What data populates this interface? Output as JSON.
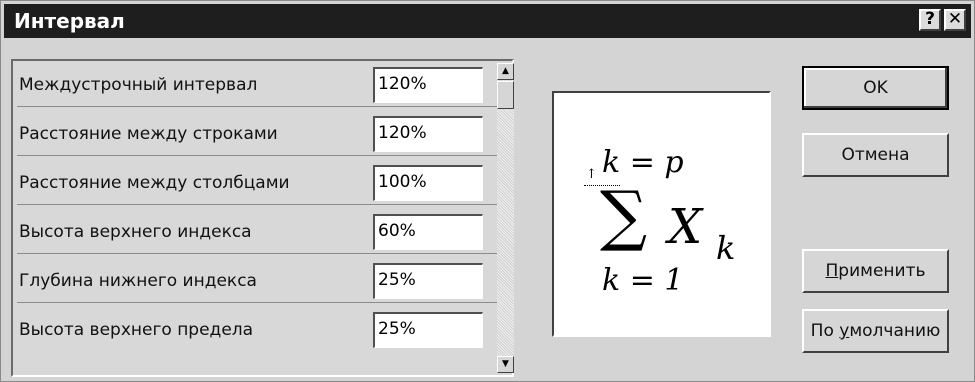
{
  "window": {
    "title": "Интервал",
    "help_label": "?",
    "close_label": "✕"
  },
  "settings": [
    {
      "label": "Междустрочный интервал",
      "value": "120%"
    },
    {
      "label": "Расстояние между строками",
      "value": "120%"
    },
    {
      "label": "Расстояние между столбцами",
      "value": "100%"
    },
    {
      "label": "Высота верхнего индекса",
      "value": "60%"
    },
    {
      "label": "Глубина нижнего индекса",
      "value": "25%"
    },
    {
      "label": "Высота верхнего предела",
      "value": "25%"
    }
  ],
  "preview": {
    "upper_limit": "k = p",
    "operator": "∑",
    "variable": "X",
    "subscript": "k",
    "lower_limit": "k = 1"
  },
  "buttons": {
    "ok": "OK",
    "cancel": "Отмена",
    "apply_first": "П",
    "apply_rest": "рименить",
    "default_pre": "По ",
    "default_u": "у",
    "default_post": "молчанию"
  }
}
